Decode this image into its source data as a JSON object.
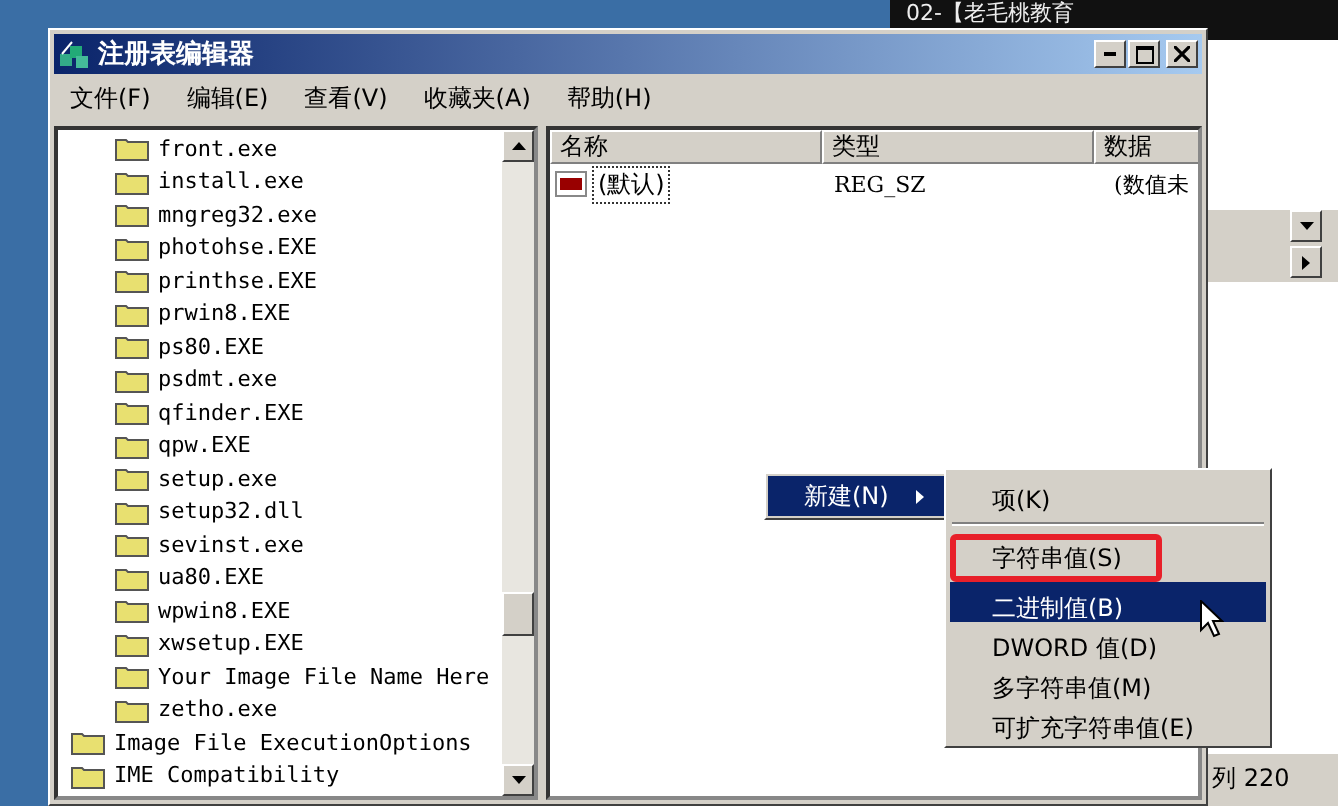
{
  "video_title": "02-【老毛桃教育",
  "background_window": {
    "status_text": "列 220"
  },
  "window": {
    "title": "注册表编辑器"
  },
  "menu": [
    {
      "label": "文件(F)"
    },
    {
      "label": "编辑(E)"
    },
    {
      "label": "查看(V)"
    },
    {
      "label": "收藏夹(A)"
    },
    {
      "label": "帮助(H)"
    }
  ],
  "tree": {
    "sub_items": [
      {
        "label": "front.exe"
      },
      {
        "label": "install.exe"
      },
      {
        "label": "mngreg32.exe"
      },
      {
        "label": "photohse.EXE"
      },
      {
        "label": "printhse.EXE"
      },
      {
        "label": "prwin8.EXE"
      },
      {
        "label": "ps80.EXE"
      },
      {
        "label": "psdmt.exe"
      },
      {
        "label": "qfinder.EXE"
      },
      {
        "label": "qpw.EXE"
      },
      {
        "label": "setup.exe"
      },
      {
        "label": "setup32.dll"
      },
      {
        "label": "sevinst.exe"
      },
      {
        "label": "ua80.EXE"
      },
      {
        "label": "wpwin8.EXE"
      },
      {
        "label": "xwsetup.EXE"
      },
      {
        "label": "Your Image File Name Here"
      },
      {
        "label": "zetho.exe"
      }
    ],
    "items": [
      {
        "label": "Image File ExecutionOptions"
      },
      {
        "label": "IME Compatibility"
      }
    ]
  },
  "list": {
    "columns": [
      "名称",
      "类型",
      "数据"
    ],
    "rows": [
      {
        "name": "(默认)",
        "type": "REG_SZ",
        "data": "(数值未"
      }
    ]
  },
  "context_menu": {
    "items": [
      {
        "label": "新建(N)",
        "selected": true
      }
    ]
  },
  "submenu": {
    "items": [
      {
        "kind": "item",
        "label": "项(K)",
        "selected": false,
        "highlighted": false
      },
      {
        "kind": "separator"
      },
      {
        "kind": "item",
        "label": "字符串值(S)",
        "selected": false,
        "highlighted": true
      },
      {
        "kind": "item",
        "label": "二进制值(B)",
        "selected": true,
        "highlighted": false
      },
      {
        "kind": "item",
        "label": "DWORD 值(D)",
        "selected": false,
        "highlighted": false
      },
      {
        "kind": "item",
        "label": "多字符串值(M)",
        "selected": false,
        "highlighted": false
      },
      {
        "kind": "item",
        "label": "可扩充字符串值(E)",
        "selected": false,
        "highlighted": false
      }
    ]
  }
}
